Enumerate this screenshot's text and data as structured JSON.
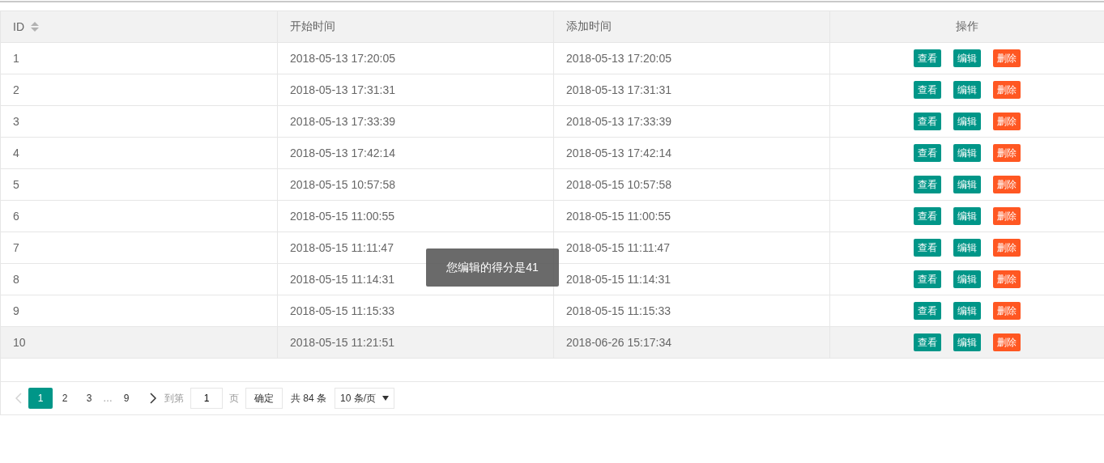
{
  "table": {
    "columns": [
      {
        "label": "ID",
        "sortable": true
      },
      {
        "label": "开始时间"
      },
      {
        "label": "添加时间"
      },
      {
        "label": "操作"
      }
    ],
    "rows": [
      {
        "id": "1",
        "start": "2018-05-13 17:20:05",
        "added": "2018-05-13 17:20:05",
        "selected": false,
        "actions": [
          {
            "label": "查看",
            "kind": "view"
          },
          {
            "label": "编辑",
            "kind": "edit"
          },
          {
            "label": "删除",
            "kind": "delete"
          }
        ]
      },
      {
        "id": "2",
        "start": "2018-05-13 17:31:31",
        "added": "2018-05-13 17:31:31",
        "selected": false,
        "actions": [
          {
            "label": "查看",
            "kind": "view"
          },
          {
            "label": "编辑",
            "kind": "edit"
          },
          {
            "label": "删除",
            "kind": "delete"
          }
        ]
      },
      {
        "id": "3",
        "start": "2018-05-13 17:33:39",
        "added": "2018-05-13 17:33:39",
        "selected": false,
        "actions": [
          {
            "label": "查看",
            "kind": "view"
          },
          {
            "label": "编辑",
            "kind": "edit"
          },
          {
            "label": "删除",
            "kind": "delete"
          }
        ]
      },
      {
        "id": "4",
        "start": "2018-05-13 17:42:14",
        "added": "2018-05-13 17:42:14",
        "selected": false,
        "actions": [
          {
            "label": "查看",
            "kind": "view"
          },
          {
            "label": "编辑",
            "kind": "edit"
          },
          {
            "label": "删除",
            "kind": "delete"
          }
        ]
      },
      {
        "id": "5",
        "start": "2018-05-15 10:57:58",
        "added": "2018-05-15 10:57:58",
        "selected": false,
        "actions": [
          {
            "label": "查看",
            "kind": "view"
          },
          {
            "label": "编辑",
            "kind": "edit"
          },
          {
            "label": "删除",
            "kind": "delete"
          }
        ]
      },
      {
        "id": "6",
        "start": "2018-05-15 11:00:55",
        "added": "2018-05-15 11:00:55",
        "selected": false,
        "actions": [
          {
            "label": "查看",
            "kind": "view"
          },
          {
            "label": "编辑",
            "kind": "edit"
          },
          {
            "label": "删除",
            "kind": "delete"
          }
        ]
      },
      {
        "id": "7",
        "start": "2018-05-15 11:11:47",
        "added": "2018-05-15 11:11:47",
        "selected": false,
        "actions": [
          {
            "label": "查看",
            "kind": "view"
          },
          {
            "label": "编辑",
            "kind": "edit"
          },
          {
            "label": "删除",
            "kind": "delete"
          }
        ]
      },
      {
        "id": "8",
        "start": "2018-05-15 11:14:31",
        "added": "2018-05-15 11:14:31",
        "selected": false,
        "actions": [
          {
            "label": "查看",
            "kind": "view"
          },
          {
            "label": "编辑",
            "kind": "edit"
          },
          {
            "label": "删除",
            "kind": "delete"
          }
        ]
      },
      {
        "id": "9",
        "start": "2018-05-15 11:15:33",
        "added": "2018-05-15 11:15:33",
        "selected": false,
        "actions": [
          {
            "label": "查看",
            "kind": "view"
          },
          {
            "label": "编辑",
            "kind": "edit"
          },
          {
            "label": "删除",
            "kind": "delete"
          }
        ]
      },
      {
        "id": "10",
        "start": "2018-05-15 11:21:51",
        "added": "2018-06-26 15:17:34",
        "selected": true,
        "actions": [
          {
            "label": "查看",
            "kind": "view"
          },
          {
            "label": "编辑",
            "kind": "edit"
          },
          {
            "label": "删除",
            "kind": "delete"
          }
        ]
      }
    ]
  },
  "toast": {
    "text": "您编辑的得分是41"
  },
  "pagination": {
    "prev_disabled": true,
    "pages": [
      {
        "label": "1",
        "selected": true,
        "kind": "page"
      },
      {
        "label": "2",
        "selected": false,
        "kind": "page"
      },
      {
        "label": "3",
        "selected": false,
        "kind": "page"
      },
      {
        "label": "…",
        "kind": "ellipsis"
      },
      {
        "label": "9",
        "selected": false,
        "kind": "page"
      }
    ],
    "goto_label": "到第",
    "goto_value": "1",
    "page_unit": "页",
    "confirm": "确定",
    "total": "共 84 条",
    "page_size": "10 条/页"
  }
}
